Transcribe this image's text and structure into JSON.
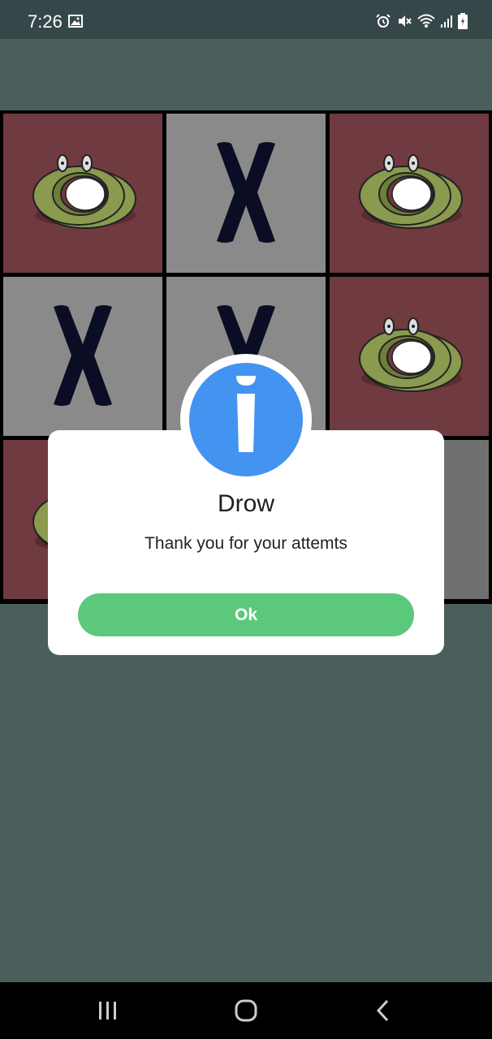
{
  "status_bar": {
    "time": "7:26",
    "icons": [
      "gallery-icon",
      "alarm-icon",
      "mute-icon",
      "wifi-icon",
      "signal-icon",
      "battery-icon"
    ]
  },
  "board": {
    "cells": [
      "O",
      "X",
      "O",
      "X",
      "X",
      "O",
      "O",
      "",
      ""
    ]
  },
  "dialog": {
    "icon": "info-icon",
    "title": "Drow",
    "message": "Thank you for your attemts",
    "ok_label": "Ok",
    "icon_color": "#4393f0",
    "button_color": "#5cc87c"
  },
  "nav_bar": {
    "buttons": [
      "recent-apps-icon",
      "home-icon",
      "back-icon"
    ]
  },
  "colors": {
    "background": "#4a5f5c",
    "o_cell": "#6f3a40",
    "x_cell": "#8a8a8a",
    "x_mark": "#0b0d24",
    "o_mark": "#8a9a4e"
  }
}
